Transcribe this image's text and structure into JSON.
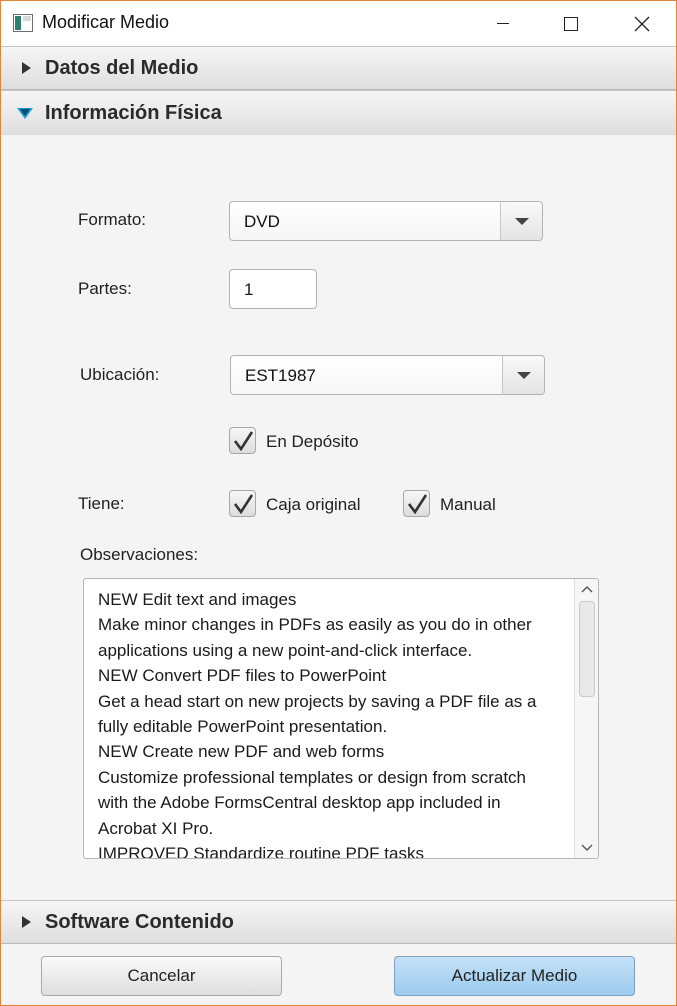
{
  "window": {
    "title": "Modificar Medio",
    "controls": [
      "minimize-icon",
      "maximize-icon",
      "close-icon"
    ]
  },
  "accordion": {
    "section1": {
      "title": "Datos del Medio",
      "expanded": false
    },
    "section2": {
      "title": "Información Física",
      "expanded": true
    },
    "section3": {
      "title": "Software Contenido",
      "expanded": false
    }
  },
  "form": {
    "formato_label": "Formato:",
    "formato_value": "DVD",
    "partes_label": "Partes:",
    "partes_value": "1",
    "ubicacion_label": "Ubicación:",
    "ubicacion_value": "EST1987",
    "en_deposito_label": "En Depósito",
    "en_deposito_checked": true,
    "tiene_label": "Tiene:",
    "caja_original_label": "Caja original",
    "caja_original_checked": true,
    "manual_label": "Manual",
    "manual_checked": true,
    "observaciones_label": "Observaciones:",
    "observaciones_lines": [
      "NEW Edit text and images",
      "Make minor changes in PDFs as easily as you do in other",
      "applications using a new point-and-click interface.",
      "NEW Convert PDF files to PowerPoint",
      "Get a head start on new projects by saving a PDF file as a",
      "fully editable PowerPoint presentation.",
      "NEW Create new PDF and web forms",
      "Customize professional templates or design from scratch",
      "with the Adobe FormsCentral desktop app included in",
      "Acrobat XI Pro.",
      "IMPROVED Standardize routine PDF tasks"
    ]
  },
  "footer": {
    "cancel_label": "Cancelar",
    "update_label": "Actualizar Medio"
  },
  "colors": {
    "window_border": "#e0853a",
    "accent_triangle": "#1f9ad6",
    "primary_button": "#a9d3f2"
  }
}
